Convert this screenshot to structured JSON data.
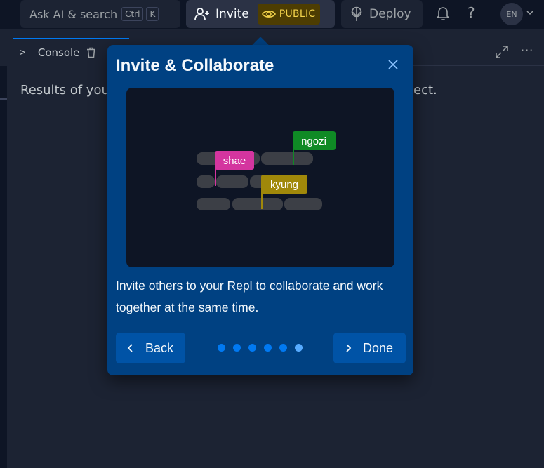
{
  "topbar": {
    "search_placeholder": "Ask AI & search",
    "kbd_ctrl": "Ctrl",
    "kbd_k": "K",
    "invite_label": "Invite",
    "public_label": "PUBLIC",
    "deploy_label": "Deploy",
    "avatar_initials": "EN",
    "help_label": "?"
  },
  "console": {
    "tab_label": "Console",
    "prompt_glyph": ">_",
    "text_left": "Results of your",
    "text_right": "ject.",
    "more_label": "···"
  },
  "popover": {
    "title": "Invite & Collaborate",
    "description": "Invite others to your Repl to collaborate and work together at the same time.",
    "back_label": "Back",
    "done_label": "Done",
    "step_total": 6,
    "step_current": 6
  },
  "illustration": {
    "cursors": [
      {
        "name": "shae",
        "color": "#d4359f"
      },
      {
        "name": "ngozi",
        "color": "#0f8a25"
      },
      {
        "name": "kyung",
        "color": "#a0880a"
      }
    ]
  },
  "colors": {
    "background": "#1c2333",
    "topbar": "#0e1525",
    "popover": "#004182",
    "button": "#0053a6",
    "accent": "#0079f2",
    "public_badge": "#4d3d02"
  },
  "icons": {
    "invite": "add-user-icon",
    "public": "eye-icon",
    "deploy": "deploy-icon",
    "notifications": "bell-icon",
    "help": "help-icon",
    "close": "close-icon",
    "back": "chevron-left-icon",
    "done": "chevron-right-icon",
    "trash": "trash-icon",
    "expand": "expand-icon"
  }
}
